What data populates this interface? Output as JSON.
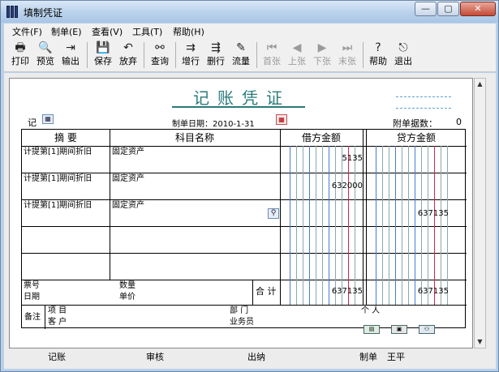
{
  "window": {
    "title": "填制凭证",
    "min_glyph": "—",
    "max_glyph": "▢",
    "close_glyph": "✕"
  },
  "menu": [
    "文件(F)",
    "制单(E)",
    "查看(V)",
    "工具(T)",
    "帮助(H)"
  ],
  "toolbar": [
    {
      "label": "打印",
      "icon": "printer-icon",
      "glyph": "🖶",
      "enabled": true
    },
    {
      "label": "预览",
      "icon": "preview-icon",
      "glyph": "🔍",
      "enabled": true
    },
    {
      "label": "输出",
      "icon": "export-icon",
      "glyph": "⇥",
      "enabled": true
    },
    {
      "label": "保存",
      "icon": "save-icon",
      "glyph": "💾",
      "enabled": true
    },
    {
      "label": "放弃",
      "icon": "undo-icon",
      "glyph": "↶",
      "enabled": true
    },
    {
      "label": "查询",
      "icon": "binoculars-icon",
      "glyph": "⚯",
      "enabled": true
    },
    {
      "label": "增行",
      "icon": "add-row-icon",
      "glyph": "⇉",
      "enabled": true
    },
    {
      "label": "删行",
      "icon": "delete-row-icon",
      "glyph": "⇶",
      "enabled": true
    },
    {
      "label": "流量",
      "icon": "flow-icon",
      "glyph": "✎",
      "enabled": true
    },
    {
      "label": "首张",
      "icon": "first-icon",
      "glyph": "⏮",
      "enabled": false
    },
    {
      "label": "上张",
      "icon": "prev-icon",
      "glyph": "◀",
      "enabled": false
    },
    {
      "label": "下张",
      "icon": "next-icon",
      "glyph": "▶",
      "enabled": false
    },
    {
      "label": "末张",
      "icon": "last-icon",
      "glyph": "⏭",
      "enabled": false
    },
    {
      "label": "帮助",
      "icon": "help-icon",
      "glyph": "?",
      "enabled": true
    },
    {
      "label": "退出",
      "icon": "exit-icon",
      "glyph": "⎋",
      "enabled": true
    }
  ],
  "voucher": {
    "title": "记账凭证",
    "type_label": "记",
    "date_label": "制单日期：2010-1-31",
    "attachment_label": "附单据数：",
    "attachment_count": "0",
    "headers": {
      "summary": "摘 要",
      "account": "科目名称",
      "debit": "借方金额",
      "credit": "贷方金额"
    },
    "rows": [
      {
        "summary": "计提第[1]期间折旧",
        "account": "固定资产",
        "debit": "5135",
        "credit": ""
      },
      {
        "summary": "计提第[1]期间折旧",
        "account": "固定资产",
        "debit": "632000",
        "credit": ""
      },
      {
        "summary": "计提第[1]期间折旧",
        "account": "固定资产",
        "debit": "",
        "credit": "637135"
      },
      {
        "summary": "",
        "account": "",
        "debit": "",
        "credit": ""
      },
      {
        "summary": "",
        "account": "",
        "debit": "",
        "credit": ""
      }
    ],
    "bottom": {
      "ticket_label": "票号",
      "date_label": "日期",
      "qty_label": "数量",
      "price_label": "单价",
      "total_label": "合 计",
      "total_debit": "637135",
      "total_credit": "637135"
    },
    "remarks": {
      "label": "备注",
      "project": "项  目",
      "customer": "客  户",
      "dept": "部  门",
      "salesman": "业务员",
      "person": "个  人"
    }
  },
  "footer": {
    "bookkeeping": "记账",
    "review": "审核",
    "cashier": "出纳",
    "maker_label": "制单",
    "maker_name": "王平"
  }
}
